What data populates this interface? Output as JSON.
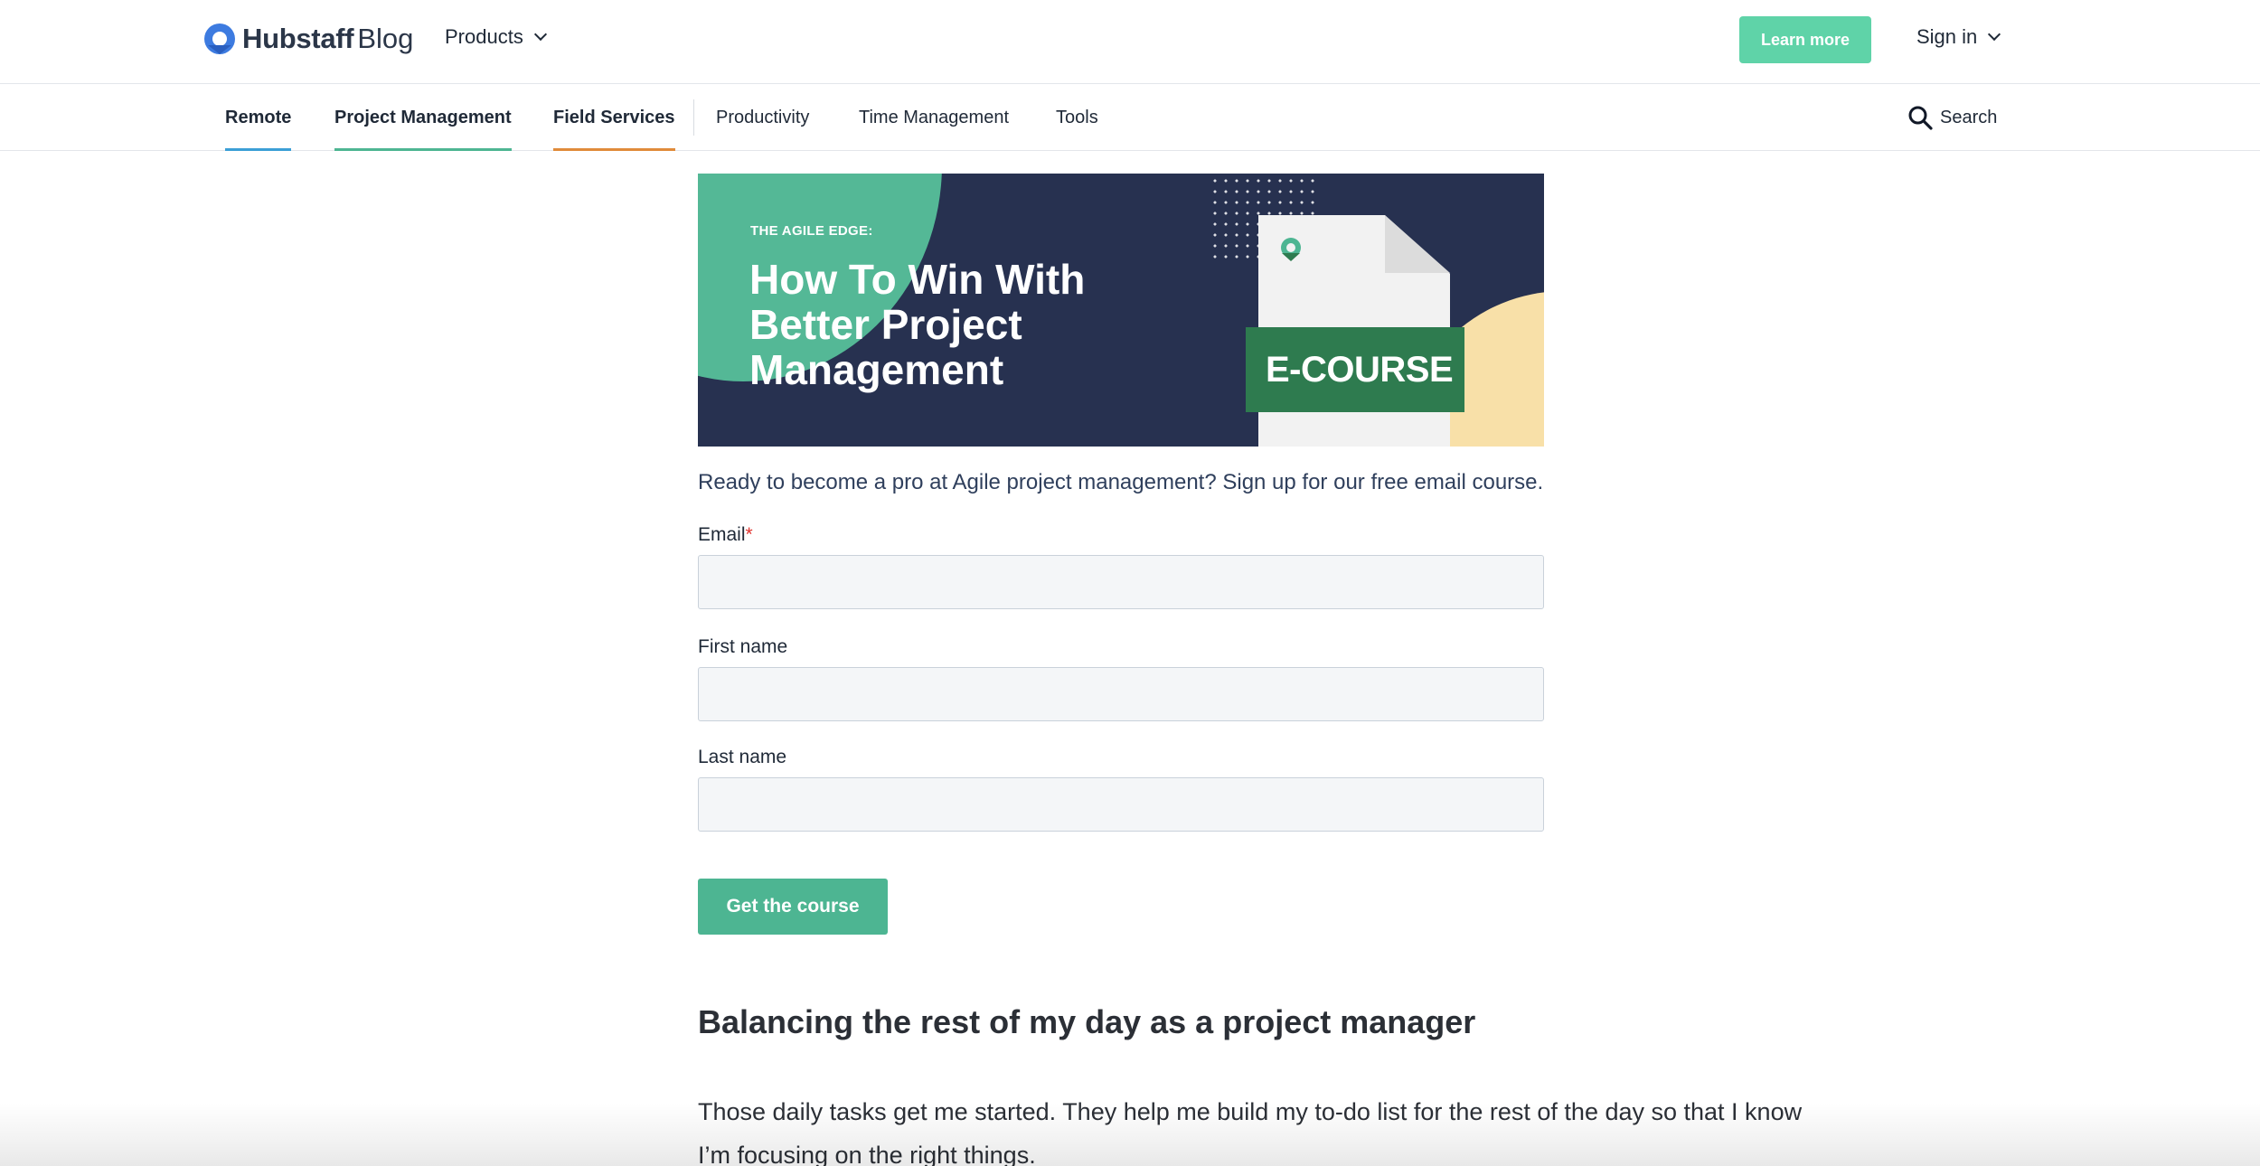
{
  "header": {
    "logo_brand": "Hubstaff",
    "logo_suffix": "Blog",
    "products_label": "Products",
    "learn_more_label": "Learn more",
    "sign_in_label": "Sign in",
    "accent_color": "#5fd3a8"
  },
  "nav": {
    "items": [
      {
        "label": "Remote",
        "underline_color": "#3b9fd6"
      },
      {
        "label": "Project Management",
        "underline_color": "#4db592"
      },
      {
        "label": "Field Services",
        "underline_color": "#e08b3a"
      },
      {
        "label": "Productivity"
      },
      {
        "label": "Time Management"
      },
      {
        "label": "Tools"
      }
    ],
    "search_label": "Search"
  },
  "banner": {
    "kicker": "THE AGILE EDGE:",
    "headline": "How To Win With Better Project Management",
    "badge": "E-COURSE"
  },
  "form": {
    "intro": "Ready to become a pro at Agile project management? Sign up for our free email course.",
    "email_label": "Email",
    "required_mark": "*",
    "email_value": "",
    "first_name_label": "First name",
    "first_name_value": "",
    "last_name_label": "Last name",
    "last_name_value": "",
    "submit_label": "Get the course",
    "button_color": "#4db592"
  },
  "article": {
    "heading": "Balancing the rest of my day as a project manager",
    "paragraph": "Those daily tasks get me started. They help me build my to-do list for the rest of the day so that I know I’m focusing on the right things."
  }
}
